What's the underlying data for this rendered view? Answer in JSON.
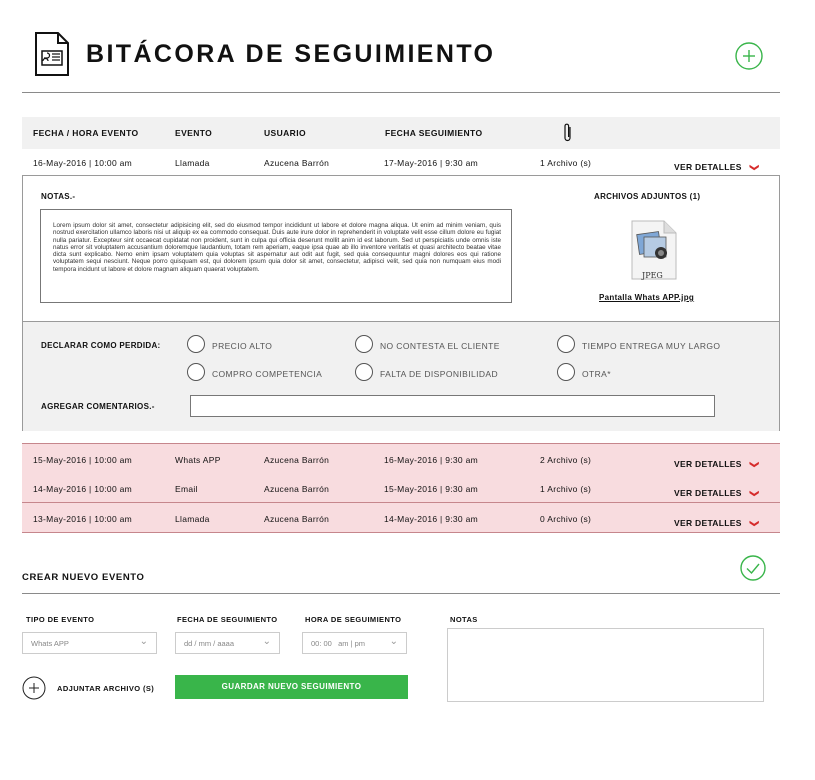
{
  "header": {
    "title": "BITÁCORA DE SEGUIMIENTO",
    "doc_icon": "document-attachment-icon",
    "add_icon": "plus-circle-icon"
  },
  "table": {
    "columns": [
      "FECHA / HORA EVENTO",
      "EVENTO",
      "USUARIO",
      "FECHA SEGUIMIENTO"
    ],
    "attachment_icon": "paperclip-icon",
    "details_label": "VER DETALLES",
    "expanded_row": {
      "fecha": "16-May-2016 | 10:00 am",
      "evento": "Llamada",
      "usuario": "Azucena Barrón",
      "seguimiento": "17-May-2016 | 9:30 am",
      "archivos": "1 Archivo (s)"
    },
    "rows": [
      {
        "fecha": "15-May-2016 | 10:00 am",
        "evento": "Whats APP",
        "usuario": "Azucena Barrón",
        "seguimiento": "16-May-2016 | 9:30 am",
        "archivos": "2 Archivo (s)"
      },
      {
        "fecha": "14-May-2016 | 10:00 am",
        "evento": "Email",
        "usuario": "Azucena Barrón",
        "seguimiento": "15-May-2016 | 9:30 am",
        "archivos": "1 Archivo (s)"
      },
      {
        "fecha": "13-May-2016 | 10:00 am",
        "evento": "Llamada",
        "usuario": "Azucena Barrón",
        "seguimiento": "14-May-2016 | 9:30 am",
        "archivos": "0 Archivo (s)"
      }
    ]
  },
  "details": {
    "notes_label": "NOTAS.-",
    "notes_text": "Lorem ipsum dolor sit amet, consectetur adipisicing elit, sed do eiusmod tempor incididunt ut labore et dolore magna aliqua. Ut enim ad minim veniam, quis nostrud exercitation ullamco laboris nisi ut aliquip ex ea commodo consequat. Duis aute irure dolor in reprehenderit in voluptate velit esse cillum dolore eu fugiat nulla pariatur. Excepteur sint occaecat cupidatat non proident, sunt in culpa qui officia deserunt mollit anim id est laborum. Sed ut perspiciatis unde omnis iste natus error sit voluptatem accusantium doloremque laudantium, totam rem aperiam, eaque ipsa quae ab illo inventore veritatis et quasi architecto beatae vitae dicta sunt explicabo. Nemo enim ipsam voluptatem quia voluptas sit aspernatur aut odit aut fugit, sed quia consequuntur magni dolores eos qui ratione voluptatem sequi nesciunt. Neque porro quisquam est, qui dolorem ipsum quia dolor sit amet, consectetur, adipisci velit, sed quia non numquam eius modi tempora incidunt ut labore et dolore magnam aliquam quaerat voluptatem.",
    "attachments_label": "ARCHIVOS ADJUNTOS (1)",
    "file_type": "JPEG",
    "file_name": "Pantalla Whats APP.jpg",
    "file_icon": "jpeg-file-icon",
    "lost_label": "DECLARAR COMO PERDIDA:",
    "lost_options": [
      "PRECIO ALTO",
      "NO CONTESTA EL CLIENTE",
      "TIEMPO ENTREGA MUY LARGO",
      "COMPRO COMPETENCIA",
      "FALTA DE DISPONIBILIDAD",
      "OTRA*"
    ],
    "comments_label": "AGREGAR COMENTARIOS.-"
  },
  "new_event": {
    "title": "CREAR NUEVO EVENTO",
    "check_icon": "check-circle-icon",
    "tipo_label": "TIPO DE EVENTO",
    "tipo_value": "Whats APP",
    "fecha_label": "FECHA DE SEGUIMIENTO",
    "fecha_placeholder": "dd / mm / aaaa",
    "hora_label": "HORA DE SEGUIMIENTO",
    "hora_placeholder": "00: 00   am | pm",
    "notas_label": "NOTAS",
    "attach_label": "ADJUNTAR ARCHIVO (S)",
    "save_label": "GUARDAR NUEVO SEGUIMIENTO"
  },
  "colors": {
    "accent_green": "#39b54a",
    "row_highlight": "#f8dcdf",
    "details_arrow": "#d62b2b"
  }
}
